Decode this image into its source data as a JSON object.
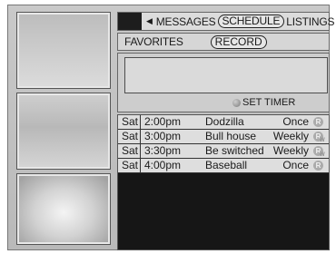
{
  "menu": {
    "items": [
      {
        "label": "MESSAGES"
      },
      {
        "label": "SCHEDULE",
        "selected": true
      },
      {
        "label": "LISTINGS"
      }
    ],
    "left_arrow_icon": "arrow-left-icon",
    "right_arrow_icon": "arrow-right-icon"
  },
  "submenu": {
    "favorites": "FAVORITES",
    "record": "RECORD"
  },
  "info": {
    "set_timer": "SET TIMER",
    "timer_icon": "timer-dot-icon"
  },
  "schedule": [
    {
      "day": "Sat",
      "time": "2:00pm",
      "title": "Dodzilla",
      "frequency": "Once",
      "badge": "R"
    },
    {
      "day": "Sat",
      "time": "3:00pm",
      "title": "Bull house",
      "frequency": "Weekly",
      "badge": "R"
    },
    {
      "day": "Sat",
      "time": "3:30pm",
      "title": "Be switched",
      "frequency": "Weekly",
      "badge": "R"
    },
    {
      "day": "Sat",
      "time": "4:00pm",
      "title": "Baseball",
      "frequency": "Once",
      "badge": "R"
    }
  ]
}
